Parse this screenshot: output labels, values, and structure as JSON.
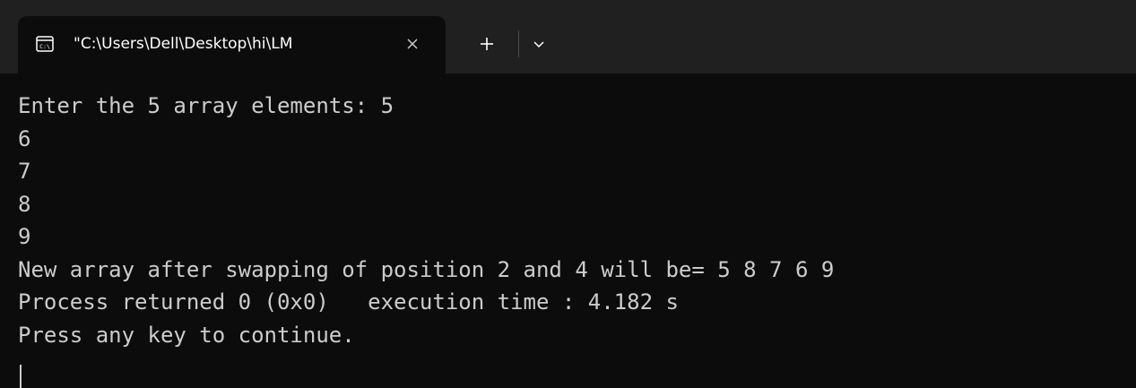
{
  "tab": {
    "title": "\"C:\\Users\\Dell\\Desktop\\hi\\LM",
    "icon": "console-icon",
    "close_icon": "close-icon"
  },
  "tabbar": {
    "new_tab_icon": "plus-icon",
    "dropdown_icon": "chevron-down-icon"
  },
  "console": {
    "lines": [
      "Enter the 5 array elements: 5",
      "6",
      "7",
      "8",
      "9",
      "New array after swapping of position 2 and 4 will be= 5 8 7 6 9",
      "Process returned 0 (0x0)   execution time : 4.182 s",
      "Press any key to continue."
    ]
  },
  "colors": {
    "background": "#0c0c0c",
    "titlebar": "#202020",
    "text": "#cccccc"
  }
}
